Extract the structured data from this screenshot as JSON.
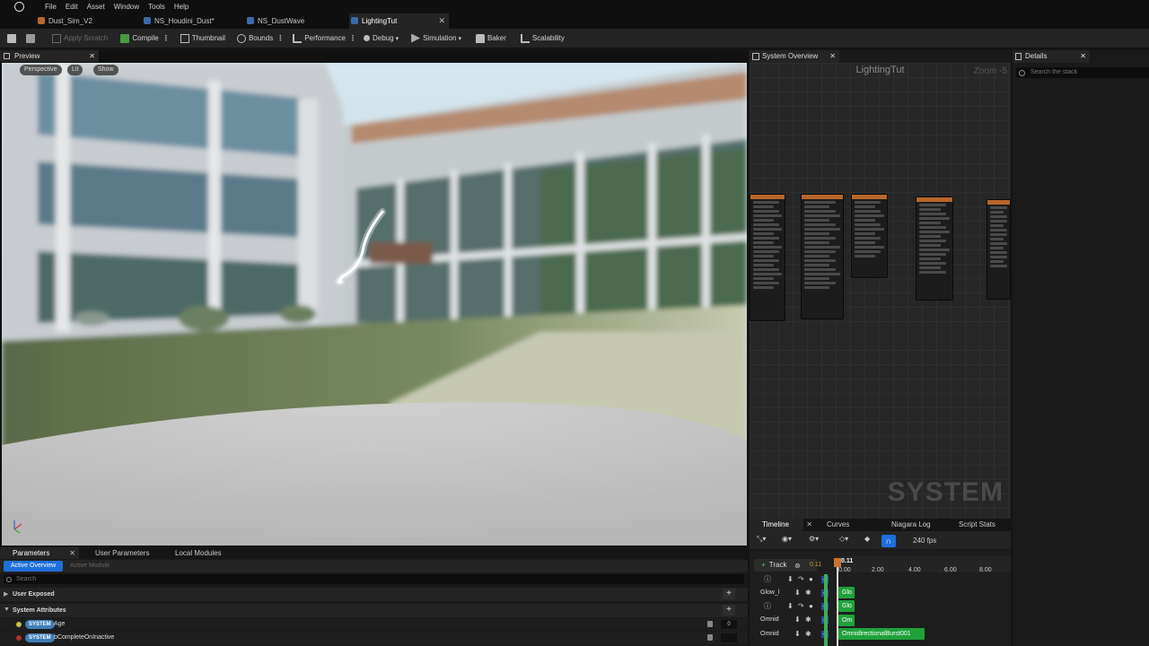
{
  "menu": [
    "File",
    "Edit",
    "Asset",
    "Window",
    "Tools",
    "Help"
  ],
  "doc_tabs": [
    {
      "label": "Dust_Sim_V2"
    },
    {
      "label": "NS_Houdini_Dust*"
    },
    {
      "label": "NS_DustWave"
    },
    {
      "label": "LightingTut"
    }
  ],
  "toolbar": {
    "apply_scratch": "Apply Scratch",
    "compile": "Compile",
    "thumbnail": "Thumbnail",
    "bounds": "Bounds",
    "performance": "Performance",
    "debug": "Debug",
    "simulation": "Simulation",
    "baker": "Baker",
    "scalability": "Scalability"
  },
  "preview": {
    "tab": "Preview",
    "perspective": "Perspective",
    "lit": "Lit",
    "show": "Show"
  },
  "system_overview": {
    "tab": "System Overview",
    "title": "LightingTut",
    "zoom": "Zoom -5",
    "watermark": "SYSTEM"
  },
  "details": {
    "tab": "Details",
    "search_placeholder": "Search the stack"
  },
  "timeline": {
    "tabs": [
      "Timeline",
      "Curves",
      "Niagara Log",
      "Script Stats"
    ],
    "fps": "240 fps",
    "add_track": "Track",
    "current_time": "0.11",
    "playhead_time": "0.11",
    "ticks": [
      "0.00",
      "2.00",
      "4.00",
      "6.00",
      "8.00"
    ],
    "tracks": [
      {
        "label": "",
        "bar": "Glo"
      },
      {
        "label": "Glow_l",
        "bar": "Glo"
      },
      {
        "label": "",
        "bar": "Om"
      },
      {
        "label": "Omnid",
        "bar": "OmnidirectionalBurst001"
      },
      {
        "label": "Omnid",
        "bar": ""
      }
    ]
  },
  "parameters": {
    "tabs": [
      "Parameters",
      "User Parameters",
      "Local Modules"
    ],
    "active_overview": "Active Overview",
    "active_module": "Active Module",
    "search_placeholder": "Search",
    "sections": [
      "User Exposed",
      "System Attributes"
    ],
    "attributes": [
      {
        "badge": "SYSTEM",
        "name": "Age",
        "value": "0"
      },
      {
        "badge": "SYSTEM",
        "name": "bCompleteOnInactive",
        "value": ""
      }
    ]
  },
  "colors": {
    "accent": "#1e6fd9",
    "track_green": "#1fa13a",
    "node_header": "#b8662a",
    "badge_blue": "#3f7fb8"
  }
}
